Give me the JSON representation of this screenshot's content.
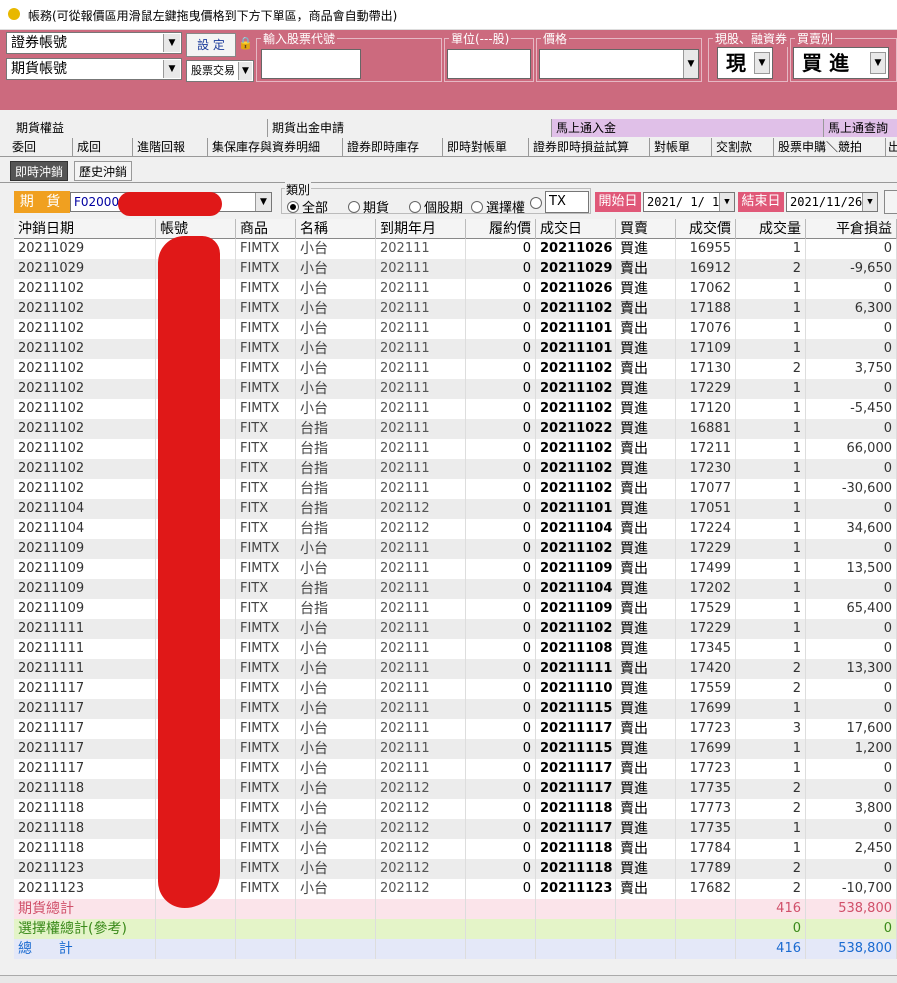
{
  "window": {
    "title": "帳務(可從報價區用滑鼠左鍵拖曳價格到下方下單區，商品會自動帶出)"
  },
  "order_panel": {
    "account_sec": "證券帳號",
    "account_fut": "期貨帳號",
    "set_label": "設 定",
    "trade_type": "股票交易",
    "stock_code_label": "輸入股票代號",
    "unit_label": "單位(---股)",
    "price_label": "價格",
    "cash_margin_label": "現股、融資券",
    "side_label": "買賣別",
    "cash_value": "現",
    "side_value": "買 進"
  },
  "tabs_row1": [
    "期貨權益",
    "期貨出金申請",
    "馬上通入金",
    "馬上通查詢"
  ],
  "tabs_row2": [
    "委回",
    "成回",
    "進階回報",
    "集保庫存與資券明細",
    "證券即時庫存",
    "即時對帳單",
    "證券即時損益試算",
    "對帳單",
    "交割款",
    "股票申購＼競拍",
    "出"
  ],
  "subtabs": [
    "即時沖銷",
    "歷史沖銷"
  ],
  "filter": {
    "label": "期 貨",
    "account": "F02000",
    "type_label": "類別",
    "radios": [
      "全部",
      "期貨",
      "個股期",
      "選擇權"
    ],
    "selected_radio": 0,
    "product": "TX",
    "start_label": "開始日",
    "start_date": "2021/ 1/ 1",
    "end_label": "結束日",
    "end_date": "2021/11/26"
  },
  "grid": {
    "headers": [
      "沖銷日期",
      "帳號",
      "商品",
      "名稱",
      "到期年月",
      "履約價",
      "成交日",
      "買賣",
      "成交價",
      "成交量",
      "平倉損益"
    ],
    "rows": [
      [
        "20211029",
        "",
        "FIMTX",
        "小台",
        "202111",
        "0",
        "20211026",
        "買進",
        "16955",
        "1",
        "0"
      ],
      [
        "20211029",
        "",
        "FIMTX",
        "小台",
        "202111",
        "0",
        "20211029",
        "賣出",
        "16912",
        "2",
        "-9,650"
      ],
      [
        "20211102",
        "",
        "FIMTX",
        "小台",
        "202111",
        "0",
        "20211026",
        "買進",
        "17062",
        "1",
        "0"
      ],
      [
        "20211102",
        "",
        "FIMTX",
        "小台",
        "202111",
        "0",
        "20211102",
        "賣出",
        "17188",
        "1",
        "6,300"
      ],
      [
        "20211102",
        "",
        "FIMTX",
        "小台",
        "202111",
        "0",
        "20211101",
        "賣出",
        "17076",
        "1",
        "0"
      ],
      [
        "20211102",
        "",
        "FIMTX",
        "小台",
        "202111",
        "0",
        "20211101",
        "買進",
        "17109",
        "1",
        "0"
      ],
      [
        "20211102",
        "",
        "FIMTX",
        "小台",
        "202111",
        "0",
        "20211102",
        "賣出",
        "17130",
        "2",
        "3,750"
      ],
      [
        "20211102",
        "",
        "FIMTX",
        "小台",
        "202111",
        "0",
        "20211102",
        "買進",
        "17229",
        "1",
        "0"
      ],
      [
        "20211102",
        "",
        "FIMTX",
        "小台",
        "202111",
        "0",
        "20211102",
        "買進",
        "17120",
        "1",
        "-5,450"
      ],
      [
        "20211102",
        "",
        "FITX",
        "台指",
        "202111",
        "0",
        "20211022",
        "買進",
        "16881",
        "1",
        "0"
      ],
      [
        "20211102",
        "",
        "FITX",
        "台指",
        "202111",
        "0",
        "20211102",
        "賣出",
        "17211",
        "1",
        "66,000"
      ],
      [
        "20211102",
        "",
        "FITX",
        "台指",
        "202111",
        "0",
        "20211102",
        "買進",
        "17230",
        "1",
        "0"
      ],
      [
        "20211102",
        "",
        "FITX",
        "台指",
        "202111",
        "0",
        "20211102",
        "賣出",
        "17077",
        "1",
        "-30,600"
      ],
      [
        "20211104",
        "",
        "FITX",
        "台指",
        "202112",
        "0",
        "20211101",
        "買進",
        "17051",
        "1",
        "0"
      ],
      [
        "20211104",
        "",
        "FITX",
        "台指",
        "202112",
        "0",
        "20211104",
        "賣出",
        "17224",
        "1",
        "34,600"
      ],
      [
        "20211109",
        "",
        "FIMTX",
        "小台",
        "202111",
        "0",
        "20211102",
        "買進",
        "17229",
        "1",
        "0"
      ],
      [
        "20211109",
        "",
        "FIMTX",
        "小台",
        "202111",
        "0",
        "20211109",
        "賣出",
        "17499",
        "1",
        "13,500"
      ],
      [
        "20211109",
        "",
        "FITX",
        "台指",
        "202111",
        "0",
        "20211104",
        "買進",
        "17202",
        "1",
        "0"
      ],
      [
        "20211109",
        "",
        "FITX",
        "台指",
        "202111",
        "0",
        "20211109",
        "賣出",
        "17529",
        "1",
        "65,400"
      ],
      [
        "20211111",
        "",
        "FIMTX",
        "小台",
        "202111",
        "0",
        "20211102",
        "買進",
        "17229",
        "1",
        "0"
      ],
      [
        "20211111",
        "",
        "FIMTX",
        "小台",
        "202111",
        "0",
        "20211108",
        "買進",
        "17345",
        "1",
        "0"
      ],
      [
        "20211111",
        "",
        "FIMTX",
        "小台",
        "202111",
        "0",
        "20211111",
        "賣出",
        "17420",
        "2",
        "13,300"
      ],
      [
        "20211117",
        "",
        "FIMTX",
        "小台",
        "202111",
        "0",
        "20211110",
        "買進",
        "17559",
        "2",
        "0"
      ],
      [
        "20211117",
        "",
        "FIMTX",
        "小台",
        "202111",
        "0",
        "20211115",
        "買進",
        "17699",
        "1",
        "0"
      ],
      [
        "20211117",
        "",
        "FIMTX",
        "小台",
        "202111",
        "0",
        "20211117",
        "賣出",
        "17723",
        "3",
        "17,600"
      ],
      [
        "20211117",
        "",
        "FIMTX",
        "小台",
        "202111",
        "0",
        "20211115",
        "買進",
        "17699",
        "1",
        "1,200"
      ],
      [
        "20211117",
        "",
        "FIMTX",
        "小台",
        "202111",
        "0",
        "20211117",
        "賣出",
        "17723",
        "1",
        "0"
      ],
      [
        "20211118",
        "",
        "FIMTX",
        "小台",
        "202112",
        "0",
        "20211117",
        "買進",
        "17735",
        "2",
        "0"
      ],
      [
        "20211118",
        "",
        "FIMTX",
        "小台",
        "202112",
        "0",
        "20211118",
        "賣出",
        "17773",
        "2",
        "3,800"
      ],
      [
        "20211118",
        "",
        "FIMTX",
        "小台",
        "202112",
        "0",
        "20211117",
        "買進",
        "17735",
        "1",
        "0"
      ],
      [
        "20211118",
        "",
        "FIMTX",
        "小台",
        "202112",
        "0",
        "20211118",
        "賣出",
        "17784",
        "1",
        "2,450"
      ],
      [
        "20211123",
        "",
        "FIMTX",
        "小台",
        "202112",
        "0",
        "20211118",
        "買進",
        "17789",
        "2",
        "0"
      ],
      [
        "20211123",
        "",
        "FIMTX",
        "小台",
        "202112",
        "0",
        "20211123",
        "賣出",
        "17682",
        "2",
        "-10,700"
      ]
    ],
    "summary": [
      {
        "label": "期貨總計",
        "qty": "416",
        "pnl": "538,800",
        "color": "#d0506a",
        "bg": "#fbe4ea"
      },
      {
        "label": "選擇權總計(參考)",
        "qty": "0",
        "pnl": "0",
        "color": "#3a8a1a",
        "bg": "#e4f4c8"
      },
      {
        "label": "總      計",
        "qty": "416",
        "pnl": "538,800",
        "color": "#1a6ad0",
        "bg": "#e4e8f8"
      }
    ]
  },
  "colors": {
    "panel": "#cc6a7e",
    "redaction": "#e01818",
    "accent_orange": "#f0a020",
    "accent_pink": "#e05878"
  }
}
